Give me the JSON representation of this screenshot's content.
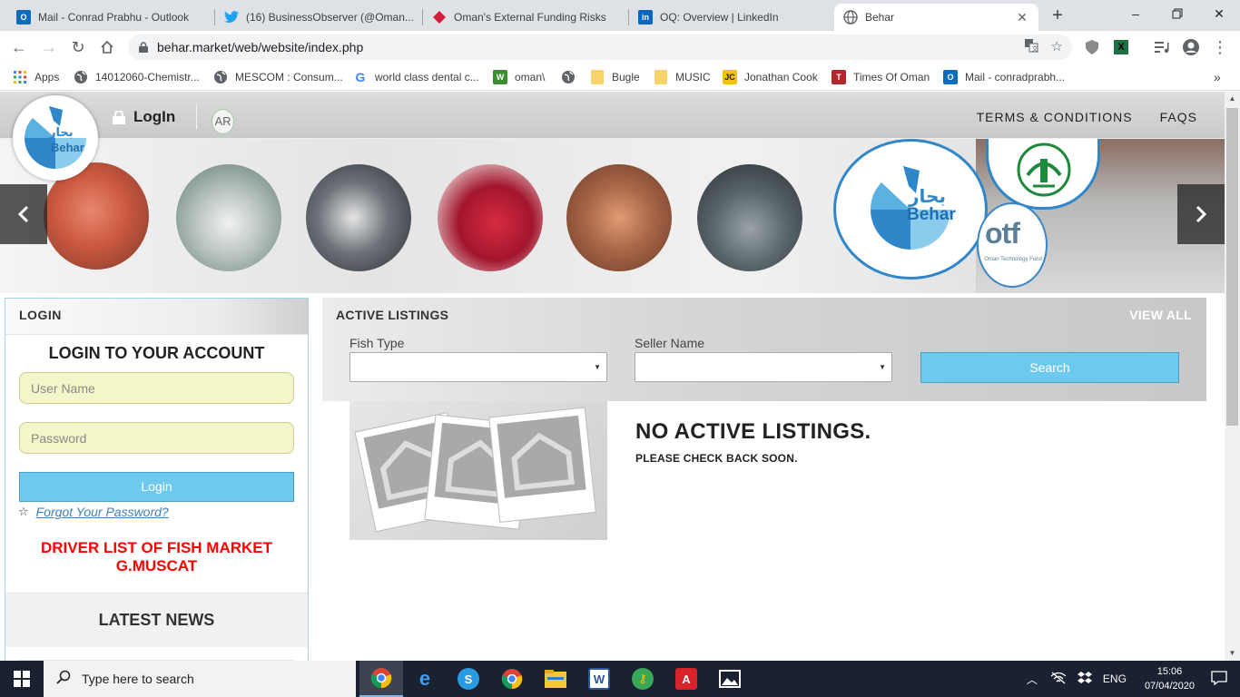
{
  "browser": {
    "tabs": [
      {
        "title": "Mail - Conrad Prabhu - Outlook",
        "icon": "outlook-icon",
        "color": "#0f6cbd"
      },
      {
        "title": "(16) BusinessObserver (@Oman...",
        "icon": "twitter-icon",
        "color": "#1da1f2"
      },
      {
        "title": "Oman's External Funding Risks",
        "icon": "diamond-icon",
        "color": "#d1203a"
      },
      {
        "title": "OQ: Overview | LinkedIn",
        "icon": "linkedin-icon",
        "color": "#0a66c2"
      },
      {
        "title": "Behar",
        "icon": "globe-icon",
        "color": "#5f6368",
        "active": true
      }
    ],
    "url": "behar.market/web/website/index.php",
    "bookmarks": [
      {
        "label": "Apps",
        "icon": "apps-grid-icon"
      },
      {
        "label": "14012060-Chemistr...",
        "icon": "globe-icon"
      },
      {
        "label": "MESCOM : Consum...",
        "icon": "globe-icon"
      },
      {
        "label": "world class dental c...",
        "icon": "google-icon"
      },
      {
        "label": "oman\\",
        "icon": "leaf-icon"
      },
      {
        "label": "",
        "icon": "globe-icon"
      },
      {
        "label": "Bugle",
        "icon": "folder-icon"
      },
      {
        "label": "MUSIC",
        "icon": "folder-icon"
      },
      {
        "label": "Jonathan Cook",
        "icon": "jc-icon"
      },
      {
        "label": "Times Of Oman",
        "icon": "times-icon"
      },
      {
        "label": "Mail - conradprabh...",
        "icon": "outlook-icon"
      }
    ],
    "more_bookmarks": "»"
  },
  "site": {
    "logo_arabic": "بحار",
    "logo_text": "Behar",
    "login_link": "LogIn",
    "lang": "AR",
    "nav": [
      "TERMS & CONDITIONS",
      "FAQS"
    ],
    "banner_logo_arabic": "بحار",
    "banner_logo_text": "Behar",
    "otf_text": "otf",
    "otf_sub": "Oman Technology Fund"
  },
  "login_panel": {
    "header": "LOGIN",
    "title": "LOGIN TO YOUR ACCOUNT",
    "username_placeholder": "User Name",
    "password_placeholder": "Password",
    "login_button": "Login",
    "forgot_link": "Forgot Your Password?",
    "driver_list_line1": "DRIVER LIST OF FISH MARKET",
    "driver_list_line2": "G.MUSCAT",
    "latest_news": "LATEST NEWS"
  },
  "listings": {
    "title": "ACTIVE LISTINGS",
    "view_all": "VIEW ALL",
    "fish_type_label": "Fish Type",
    "fish_type_value": "",
    "seller_label": "Seller Name",
    "seller_value": "",
    "search_button": "Search",
    "no_listings": "NO ACTIVE LISTINGS.",
    "check_back": "PLEASE CHECK BACK SOON."
  },
  "taskbar": {
    "search_placeholder": "Type here to search",
    "language": "ENG",
    "time": "15:06",
    "date": "07/04/2020"
  },
  "colors": {
    "accent_blue": "#6ec9ef",
    "alert_red": "#ff0000",
    "input_yellow": "#f4f5c8"
  }
}
